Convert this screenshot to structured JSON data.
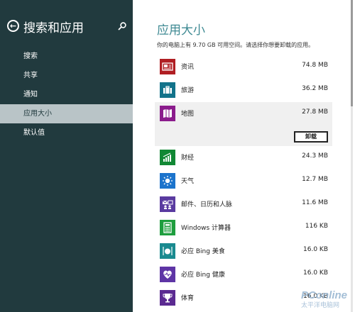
{
  "sidebar": {
    "title": "搜索和应用",
    "items": [
      {
        "label": "搜索"
      },
      {
        "label": "共享"
      },
      {
        "label": "通知"
      },
      {
        "label": "应用大小",
        "active": true
      },
      {
        "label": "默认值"
      }
    ]
  },
  "main": {
    "title": "应用大小",
    "description": "你的电脑上有 9.70 GB 可用空间。请选择你想要卸载的应用。",
    "uninstall_label": "卸载",
    "apps": [
      {
        "name": "资讯",
        "size": "74.8 MB",
        "color": "#b01e23",
        "icon": "news-icon"
      },
      {
        "name": "旅游",
        "size": "36.2 MB",
        "color": "#12738a",
        "icon": "travel-icon"
      },
      {
        "name": "地图",
        "size": "27.8 MB",
        "color": "#8b1c8c",
        "icon": "maps-icon",
        "expanded": true
      },
      {
        "name": "财经",
        "size": "24.3 MB",
        "color": "#118834",
        "icon": "finance-icon"
      },
      {
        "name": "天气",
        "size": "12.7 MB",
        "color": "#1c74cc",
        "icon": "weather-icon"
      },
      {
        "name": "邮件、日历和人脉",
        "size": "11.6 MB",
        "color": "#5a3ba0",
        "icon": "mail-calendar-people-icon"
      },
      {
        "name": "Windows 计算器",
        "size": "116 KB",
        "color": "#1e9e3e",
        "icon": "calculator-icon"
      },
      {
        "name": "必应 Bing 美食",
        "size": "16.0 KB",
        "color": "#1a8a8f",
        "icon": "food-icon"
      },
      {
        "name": "必应 Bing 健康",
        "size": "16.0 KB",
        "color": "#5e35a5",
        "icon": "health-icon"
      },
      {
        "name": "体育",
        "size": "16.0 KB",
        "color": "#5b2a91",
        "icon": "sports-icon"
      }
    ]
  },
  "watermark": {
    "text": "PConline",
    "subtext": "太平洋电脑网"
  }
}
